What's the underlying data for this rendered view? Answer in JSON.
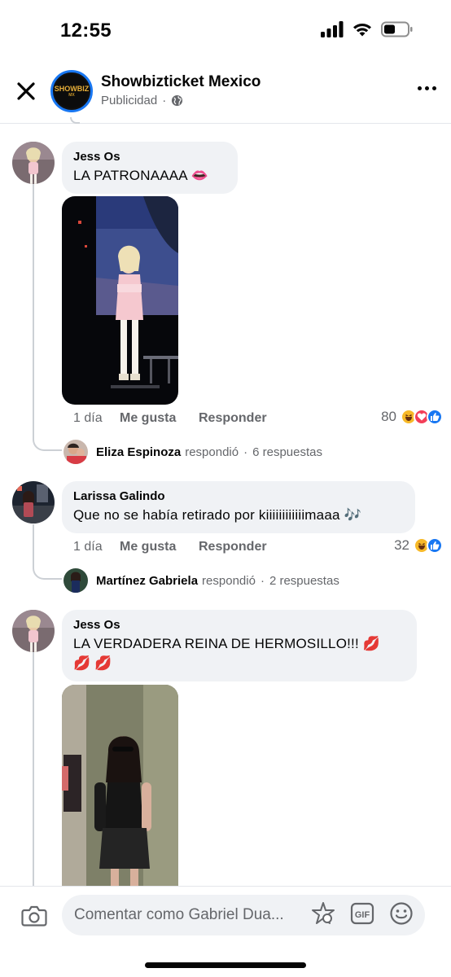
{
  "status_bar": {
    "time": "12:55"
  },
  "header": {
    "page_name": "Showbizticket Mexico",
    "subtitle": "Publicidad",
    "separator": "·",
    "logo_text": "SHOWBIZ",
    "logo_sub": "MX"
  },
  "comments": [
    {
      "author": "Jess Os",
      "text": "LA PATRONAAAA 👄",
      "time": "1 día",
      "like_label": "Me gusta",
      "reply_label": "Responder",
      "reaction_count": "80",
      "reactions": [
        "haha-icon",
        "love-icon",
        "like-icon"
      ],
      "replies": {
        "author": "Eliza Espinoza",
        "verb": "respondió",
        "sep": "·",
        "count": "6 respuestas"
      }
    },
    {
      "author": "Larissa Galindo",
      "text": "Que no se había retirado por kiiiiiiiiiiiimaaa 🎶",
      "time": "1 día",
      "like_label": "Me gusta",
      "reply_label": "Responder",
      "reaction_count": "32",
      "reactions": [
        "haha-icon",
        "like-icon"
      ],
      "replies": {
        "author": "Martínez Gabriela",
        "verb": "respondió",
        "sep": "·",
        "count": "2 respuestas"
      }
    },
    {
      "author": "Jess Os",
      "text_line1": "LA VERDADERA REINA DE HERMOSILLO!!! 💋",
      "text_line2": "💋 💋"
    }
  ],
  "composer": {
    "placeholder": "Comentar como Gabriel Dua..."
  },
  "colors": {
    "accent": "#1877f2",
    "bubble": "#f0f2f5",
    "secondary_text": "#65676b"
  }
}
